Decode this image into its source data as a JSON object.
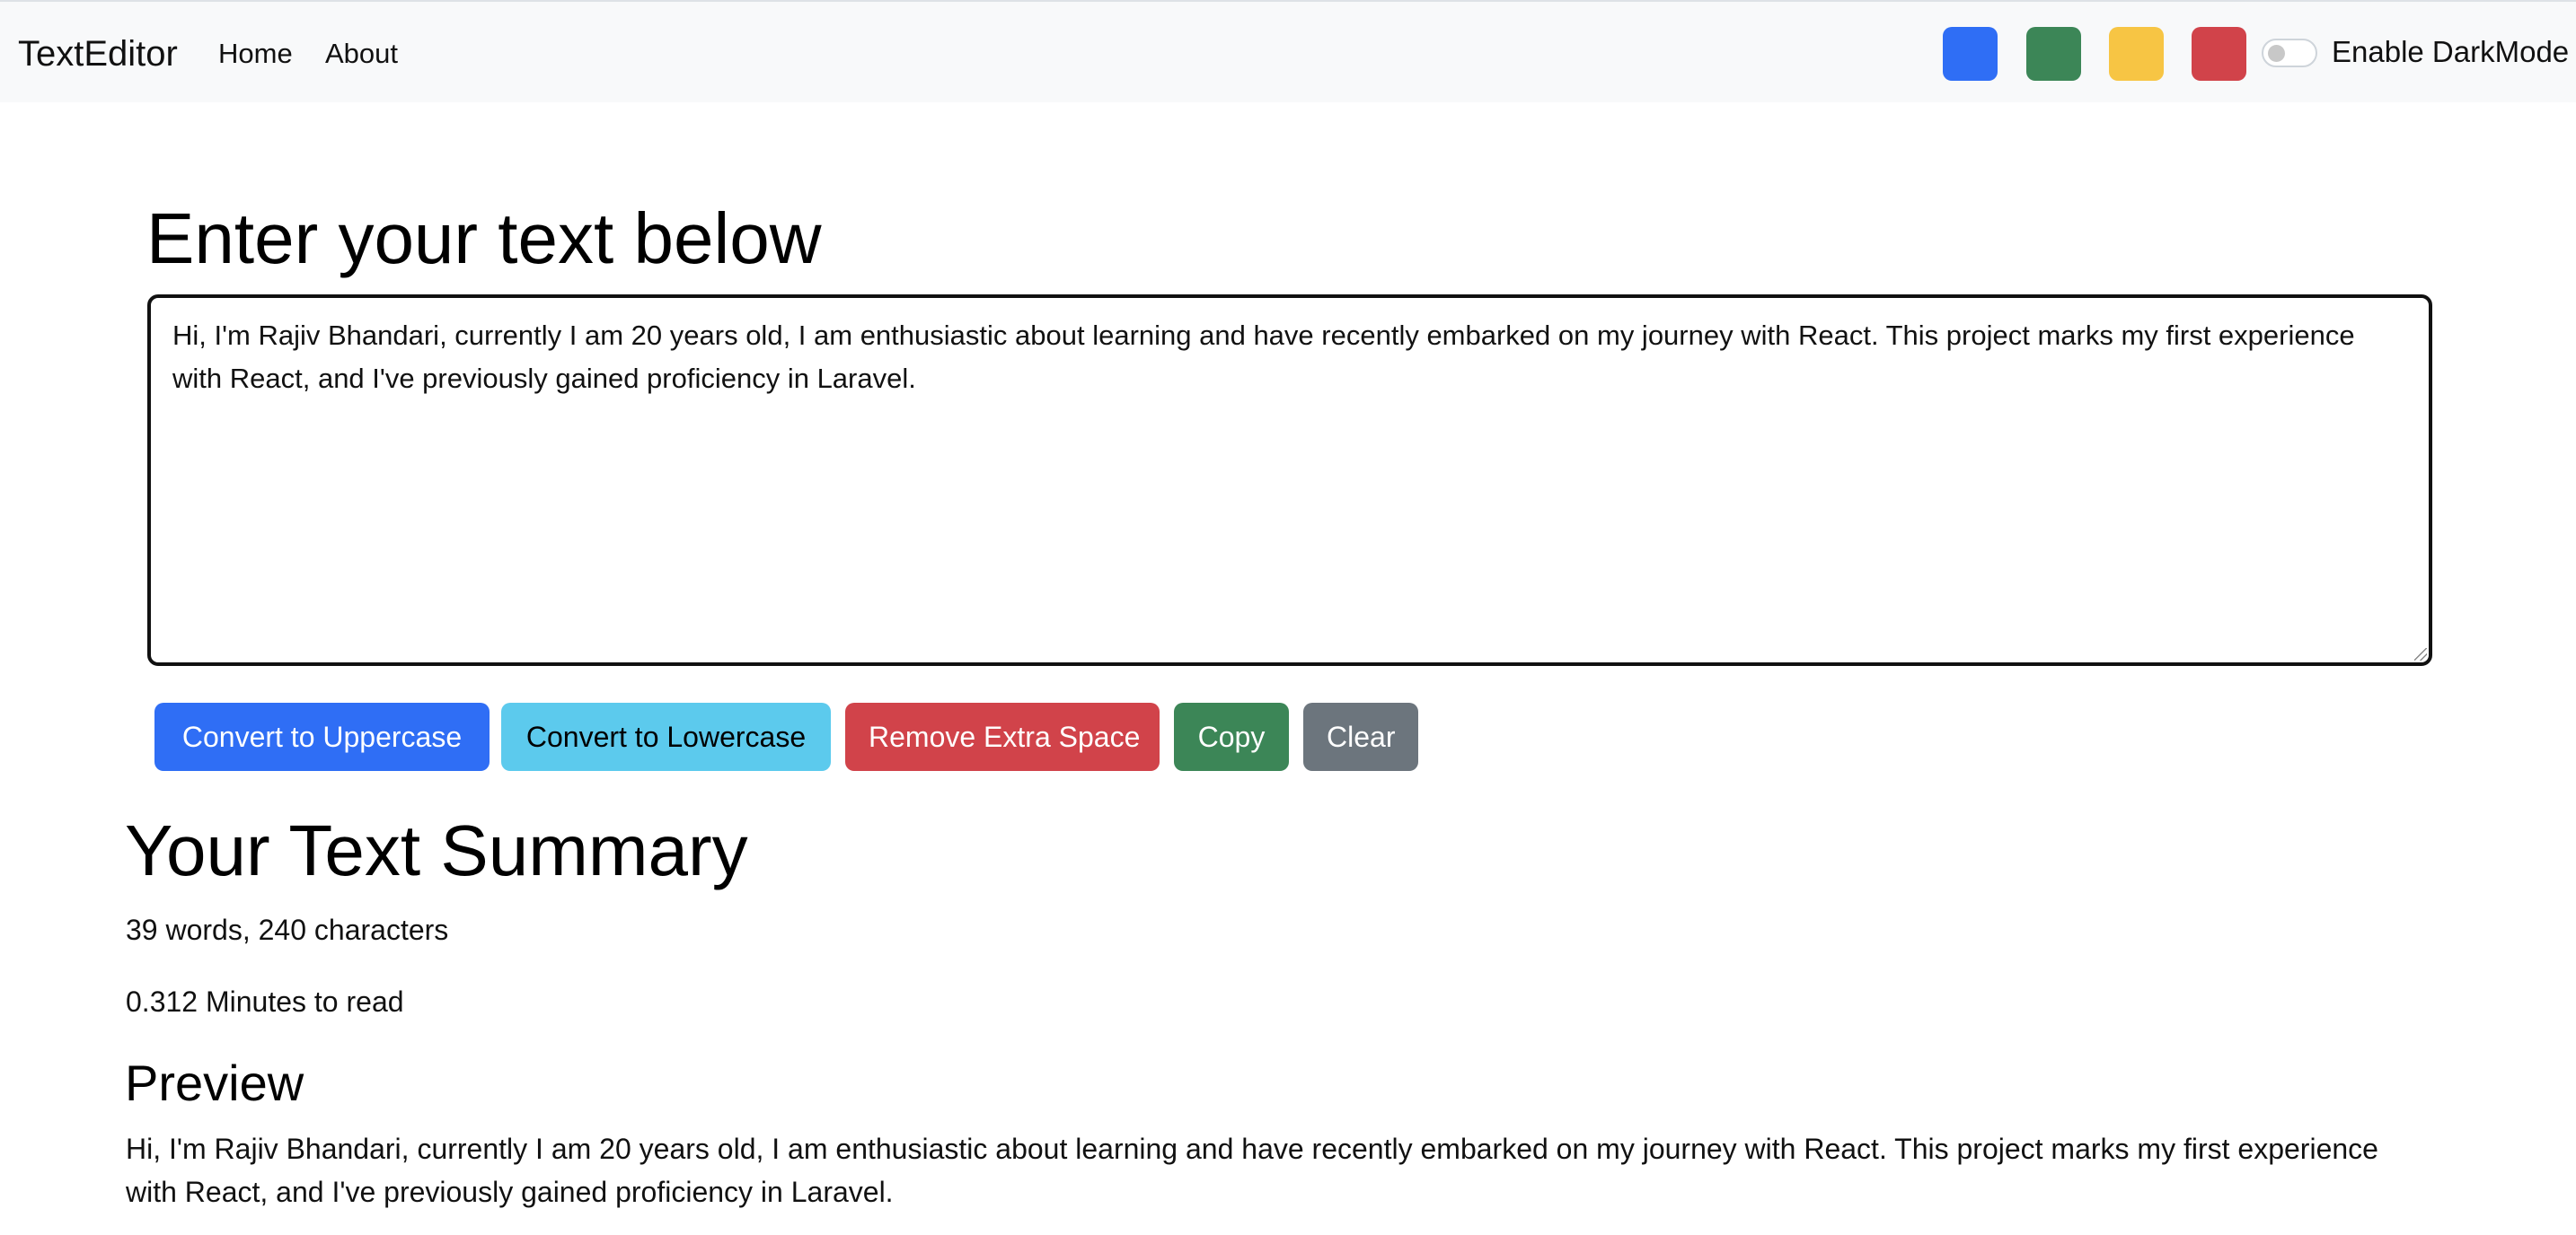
{
  "navbar": {
    "brand": "TextEditor",
    "links": [
      {
        "label": "Home"
      },
      {
        "label": "About"
      }
    ],
    "theme_swatches": [
      {
        "name": "blue",
        "color": "#2f6ef5"
      },
      {
        "name": "green",
        "color": "#3c8657"
      },
      {
        "name": "yellow",
        "color": "#f7c544"
      },
      {
        "name": "red",
        "color": "#d1434a"
      }
    ],
    "dark_mode": {
      "label": "Enable DarkMode",
      "enabled": false
    }
  },
  "editor": {
    "heading": "Enter your text below",
    "text": "Hi, I'm Rajiv Bhandari, currently I am 20 years old, I am enthusiastic about learning and have recently embarked on my journey with React. This project marks my first experience with React, and I've previously gained proficiency in Laravel."
  },
  "actions": {
    "uppercase": "Convert to Uppercase",
    "lowercase": "Convert to Lowercase",
    "remove_space": "Remove Extra Space",
    "copy": "Copy",
    "clear": "Clear"
  },
  "summary": {
    "heading": "Your Text Summary",
    "counts": "39 words, 240 characters",
    "read_time": "0.312 Minutes to read"
  },
  "preview": {
    "heading": "Preview",
    "text": "Hi, I'm Rajiv Bhandari, currently I am 20 years old, I am enthusiastic about learning and have recently embarked on my journey with React. This project marks my first experience with React, and I've previously gained proficiency in Laravel."
  }
}
